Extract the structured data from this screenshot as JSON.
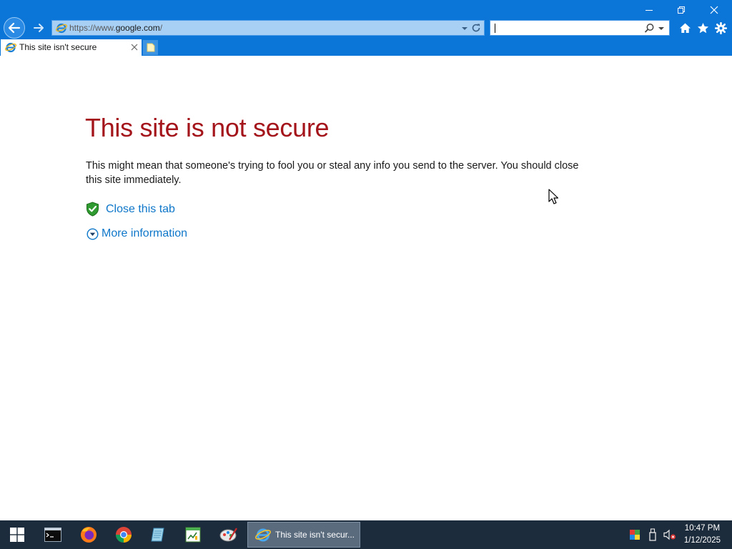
{
  "browser": {
    "url_scheme": "https://www.",
    "url_host": "google.com",
    "url_path": "/",
    "search_value": "",
    "tab_title": "This site isn't secure"
  },
  "page": {
    "heading": "This site is not secure",
    "message": "This might mean that someone's trying to fool you or steal any info you send to the server. You should close this site immediately.",
    "close_tab_link": "Close this tab",
    "more_info_link": "More information"
  },
  "taskbar": {
    "items": [
      "start-icon",
      "terminal-icon",
      "firefox-icon",
      "chrome-icon",
      "notepad-icon",
      "spreadsheet-icon",
      "paint-icon"
    ],
    "active_window_label": "This site isn't secur...",
    "time": "10:47 PM",
    "date": "1/12/2025"
  },
  "colors": {
    "chrome_blue": "#0b76d8",
    "heading_red": "#a4151b",
    "link_blue": "#0e77c9",
    "taskbar": "#1d2c3c"
  }
}
